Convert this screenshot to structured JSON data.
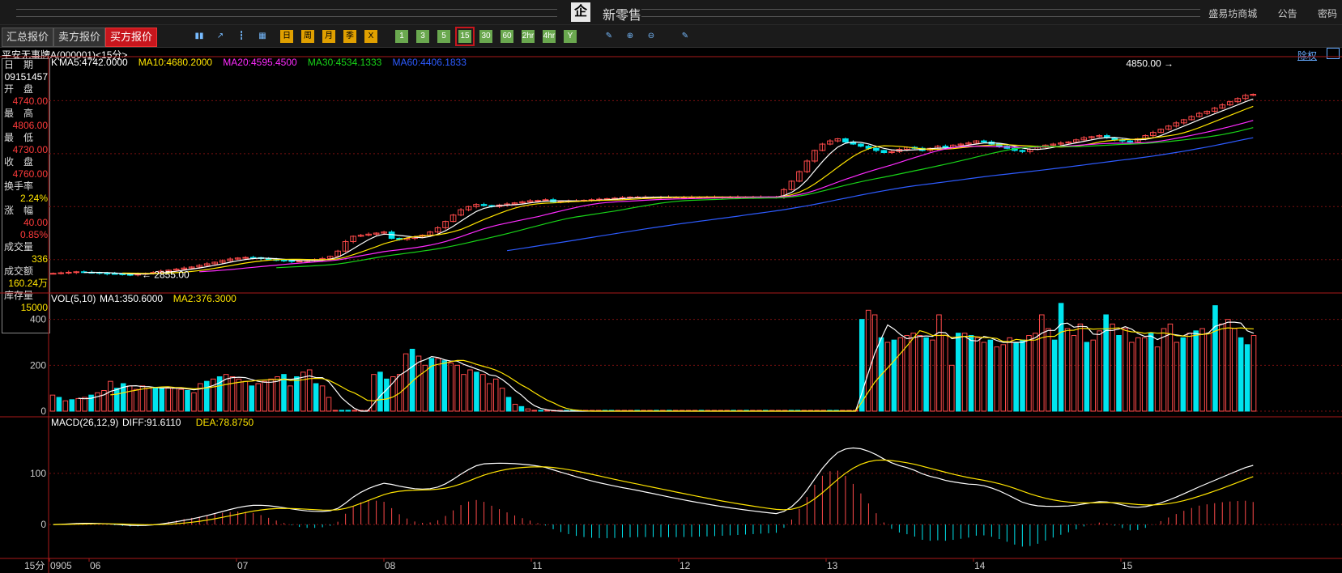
{
  "header": {
    "title": "新零售",
    "links": [
      "盛易坊商城",
      "公告",
      "密码"
    ]
  },
  "tabs": [
    {
      "label": "汇总报价",
      "active": false
    },
    {
      "label": "卖方报价",
      "active": false
    },
    {
      "label": "买方报价",
      "active": true
    }
  ],
  "toolbar": {
    "chart_icons": [
      "kline-bar-icon",
      "kline-line-icon",
      "candlestick-icon",
      "calendar-icon"
    ],
    "period_buttons": [
      "日",
      "周",
      "月",
      "季",
      "X"
    ],
    "minute_buttons": [
      "1",
      "3",
      "5",
      "15",
      "30",
      "60",
      "2hr",
      "4hr",
      "Y"
    ],
    "selected_minute": "15",
    "tool_icons": [
      "note-icon",
      "zoom-in-icon",
      "zoom-out-icon",
      "settings-icon"
    ]
  },
  "instrument": {
    "name": "平安无事牌A(000001)<15分>",
    "right_label": "除权"
  },
  "side_panel": [
    {
      "label": "日　期",
      "value": "09151457",
      "color": "#ffffff"
    },
    {
      "label": "开　盘",
      "value": "4740.00",
      "color": "#ff3b3b"
    },
    {
      "label": "最　高",
      "value": "4806.00",
      "color": "#ff3b3b"
    },
    {
      "label": "最　低",
      "value": "4730.00",
      "color": "#ff3b3b"
    },
    {
      "label": "收　盘",
      "value": "4760.00",
      "color": "#ff3b3b"
    },
    {
      "label": "换手率",
      "value": "2.24%",
      "color": "#ffe400"
    },
    {
      "label": "涨　幅",
      "value": "40.00",
      "value2": "0.85%",
      "color": "#ff3b3b"
    },
    {
      "label": "成交量",
      "value": "336",
      "color": "#ffe400"
    },
    {
      "label": "成交额",
      "value": "160.24万",
      "color": "#ffe400"
    },
    {
      "label": "库存量",
      "value": "15000",
      "color": "#ffe400"
    }
  ],
  "colors": {
    "up": "#ff4a4a",
    "down": "#00e5ee",
    "ma5": "#ffffff",
    "ma10": "#ffe400",
    "ma20": "#ff2bff",
    "ma30": "#18d418",
    "ma60": "#2d5bff",
    "grid": "#7a1010"
  },
  "chart_data": [
    {
      "type": "candlestick",
      "title": "K",
      "legend": [
        {
          "name": "MA5",
          "value": "4742.0000",
          "color": "#ffffff"
        },
        {
          "name": "MA10",
          "value": "4680.2000",
          "color": "#ffe400"
        },
        {
          "name": "MA20",
          "value": "4595.4500",
          "color": "#ff2bff"
        },
        {
          "name": "MA30",
          "value": "4534.1333",
          "color": "#18d418"
        },
        {
          "name": "MA60",
          "value": "4406.1833",
          "color": "#2d5bff"
        }
      ],
      "ylim": [
        2700,
        4900
      ],
      "annotations": [
        {
          "text": "4850.00",
          "arrow": "right",
          "value": 4850
        },
        {
          "text": "2855.00",
          "arrow": "left",
          "value": 2855
        }
      ],
      "closes": [
        2870,
        2875,
        2880,
        2885,
        2880,
        2878,
        2872,
        2868,
        2865,
        2860,
        2858,
        2862,
        2870,
        2878,
        2890,
        2900,
        2910,
        2920,
        2930,
        2945,
        2960,
        2975,
        2990,
        3005,
        3015,
        3020,
        3018,
        3010,
        3000,
        2995,
        2990,
        2985,
        2985,
        2990,
        3000,
        3010,
        3030,
        3080,
        3170,
        3220,
        3230,
        3240,
        3250,
        3260,
        3200,
        3190,
        3200,
        3210,
        3230,
        3260,
        3300,
        3360,
        3420,
        3470,
        3500,
        3520,
        3510,
        3500,
        3515,
        3525,
        3535,
        3545,
        3555,
        3558,
        3565,
        3545,
        3550,
        3555,
        3555,
        3560,
        3565,
        3570,
        3575,
        3580,
        3585,
        3590,
        3590,
        3590,
        3590,
        3590,
        3590,
        3590,
        3590,
        3590,
        3590,
        3590,
        3590,
        3590,
        3590,
        3590,
        3590,
        3590,
        3590,
        3590,
        3590,
        3660,
        3740,
        3830,
        3930,
        4030,
        4090,
        4120,
        4140,
        4110,
        4090,
        4070,
        4050,
        4030,
        4010,
        4020,
        4040,
        4060,
        4050,
        4030,
        4050,
        4070,
        4060,
        4080,
        4090,
        4100,
        4120,
        4110,
        4090,
        4070,
        4050,
        4030,
        4020,
        4040,
        4060,
        4080,
        4090,
        4100,
        4110,
        4130,
        4150,
        4160,
        4170,
        4150,
        4130,
        4120,
        4110,
        4140,
        4170,
        4200,
        4230,
        4260,
        4290,
        4320,
        4350,
        4380,
        4400,
        4430,
        4460,
        4490,
        4520,
        4550,
        4560
      ]
    },
    {
      "type": "bar",
      "title": "VOL(5,10)",
      "legend": [
        {
          "name": "MA1",
          "value": "350.6000",
          "color": "#ffffff"
        },
        {
          "name": "MA2",
          "value": "376.3000",
          "color": "#ffe400"
        }
      ],
      "ylim": [
        0,
        480
      ],
      "yticks": [
        0,
        200,
        400
      ],
      "values": [
        70,
        60,
        45,
        50,
        55,
        60,
        70,
        80,
        90,
        130,
        100,
        120,
        110,
        95,
        110,
        100,
        100,
        100,
        100,
        100,
        95,
        90,
        80,
        120,
        130,
        140,
        150,
        160,
        150,
        140,
        130,
        110,
        120,
        130,
        140,
        150,
        160,
        110,
        150,
        170,
        180,
        120,
        110,
        60,
        0,
        0,
        0,
        0,
        0,
        0,
        160,
        170,
        140,
        150,
        160,
        250,
        270,
        240,
        200,
        230,
        230,
        220,
        210,
        200,
        160,
        180,
        170,
        160,
        120,
        140,
        100,
        60,
        30,
        20,
        10,
        0,
        0,
        0,
        0,
        0,
        0,
        0,
        0,
        0,
        0,
        0,
        0,
        0,
        0,
        0,
        0,
        0,
        0,
        0,
        0,
        0,
        0,
        0,
        0,
        0,
        0,
        0,
        0,
        0,
        0,
        0,
        0,
        0,
        0,
        0,
        0,
        0,
        0,
        0,
        0,
        0,
        0,
        0,
        0,
        0,
        0,
        0,
        0,
        0,
        0,
        0,
        400,
        440,
        420,
        320,
        300,
        310,
        320,
        330,
        340,
        330,
        320,
        310,
        420,
        330,
        200,
        340,
        340,
        330,
        320,
        300,
        310,
        280,
        290,
        320,
        300,
        310,
        330,
        340,
        420,
        360,
        310,
        470,
        360,
        330,
        380,
        300,
        310,
        350,
        420,
        380,
        330,
        360,
        300,
        320,
        320,
        340,
        280,
        360,
        380,
        300,
        320,
        340,
        350,
        360,
        340,
        460,
        380,
        400,
        360,
        320,
        290,
        330
      ],
      "x_ticks": [
        "0905",
        "06",
        "07",
        "08",
        "11",
        "12",
        "13",
        "14",
        "15"
      ],
      "x_period": "15分"
    },
    {
      "type": "line",
      "title": "MACD(26,12,9)",
      "legend": [
        {
          "name": "DIFF",
          "value": "91.6110",
          "color": "#ffffff"
        },
        {
          "name": "DEA",
          "value": "78.8750",
          "color": "#ffe400"
        }
      ],
      "ylim": [
        -60,
        190
      ],
      "yticks": [
        0,
        100
      ]
    }
  ]
}
